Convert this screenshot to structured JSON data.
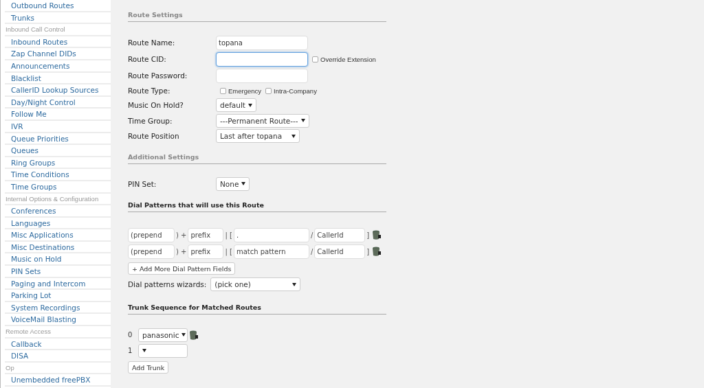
{
  "sidebar": {
    "items": [
      {
        "kind": "link",
        "label": "Outbound Routes"
      },
      {
        "kind": "link",
        "label": "Trunks"
      },
      {
        "kind": "header",
        "label": "Inbound Call Control"
      },
      {
        "kind": "link",
        "label": "Inbound Routes"
      },
      {
        "kind": "link",
        "label": "Zap Channel DIDs"
      },
      {
        "kind": "link",
        "label": "Announcements"
      },
      {
        "kind": "link",
        "label": "Blacklist"
      },
      {
        "kind": "link",
        "label": "CallerID Lookup Sources"
      },
      {
        "kind": "link",
        "label": "Day/Night Control"
      },
      {
        "kind": "link",
        "label": "Follow Me"
      },
      {
        "kind": "link",
        "label": "IVR"
      },
      {
        "kind": "link",
        "label": "Queue Priorities"
      },
      {
        "kind": "link",
        "label": "Queues"
      },
      {
        "kind": "link",
        "label": "Ring Groups"
      },
      {
        "kind": "link",
        "label": "Time Conditions"
      },
      {
        "kind": "link",
        "label": "Time Groups"
      },
      {
        "kind": "header",
        "label": "Internal Options & Configuration"
      },
      {
        "kind": "link",
        "label": "Conferences"
      },
      {
        "kind": "link",
        "label": "Languages"
      },
      {
        "kind": "link",
        "label": "Misc Applications"
      },
      {
        "kind": "link",
        "label": "Misc Destinations"
      },
      {
        "kind": "link",
        "label": "Music on Hold"
      },
      {
        "kind": "link",
        "label": "PIN Sets"
      },
      {
        "kind": "link",
        "label": "Paging and Intercom"
      },
      {
        "kind": "link",
        "label": "Parking Lot"
      },
      {
        "kind": "link",
        "label": "System Recordings"
      },
      {
        "kind": "link",
        "label": "VoiceMail Blasting"
      },
      {
        "kind": "header",
        "label": "Remote Access"
      },
      {
        "kind": "link",
        "label": "Callback"
      },
      {
        "kind": "link",
        "label": "DISA"
      },
      {
        "kind": "header",
        "label": "Op"
      },
      {
        "kind": "link",
        "label": "Unembedded freePBX"
      }
    ]
  },
  "route_settings": {
    "heading": "Route Settings",
    "fields": [
      {
        "kind": "text",
        "label": "Route Name:",
        "value": "topana",
        "focused": false
      },
      {
        "kind": "text",
        "label": "Route CID:",
        "focused": true,
        "checkboxes": [
          {
            "label": "Override Extension",
            "checked": false
          }
        ]
      },
      {
        "kind": "text",
        "label": "Route Password:",
        "focused": false
      },
      {
        "kind": "checks",
        "label": "Route Type:",
        "checkboxes": [
          {
            "label": "Emergency",
            "checked": false
          },
          {
            "label": "Intra-Company",
            "checked": false
          }
        ]
      },
      {
        "kind": "select",
        "label": "Music On Hold?",
        "value": "default"
      },
      {
        "kind": "select",
        "label": "Time Group:",
        "value": "---Permanent Route---"
      },
      {
        "kind": "select",
        "label": "Route Position",
        "value": "Last after topana",
        "wide": true
      }
    ]
  },
  "additional_settings": {
    "heading": "Additional Settings",
    "fields": [
      {
        "kind": "select",
        "label": "PIN Set:",
        "value": "None"
      }
    ]
  },
  "dial_patterns": {
    "heading": "Dial Patterns that will use this Route",
    "rows": [
      {
        "prepend": {
          "placeholder": "(prepend"
        },
        "plus": ") +",
        "prefix": {
          "placeholder": "prefix"
        },
        "bracket": "| [",
        "pattern": {
          "value": "."
        },
        "slash": "/",
        "callerid": {
          "placeholder": "CallerId"
        },
        "close": "]"
      },
      {
        "prepend": {
          "placeholder": "(prepend"
        },
        "plus": ") +",
        "prefix": {
          "placeholder": "prefix"
        },
        "bracket": "| [",
        "pattern": {
          "placeholder": "match pattern"
        },
        "slash": "/",
        "callerid": {
          "placeholder": "CallerId"
        },
        "close": "]"
      }
    ],
    "add_button": "+ Add More Dial Pattern Fields",
    "wizard": {
      "label": "Dial patterns wizards:",
      "value": "(pick one)"
    }
  },
  "trunk_sequence": {
    "heading": "Trunk Sequence for Matched Routes",
    "rows": [
      {
        "index": "0",
        "value": "panasonic",
        "deletable": true
      },
      {
        "index": "1",
        "deletable": false
      }
    ],
    "add_button": "Add Trunk"
  }
}
